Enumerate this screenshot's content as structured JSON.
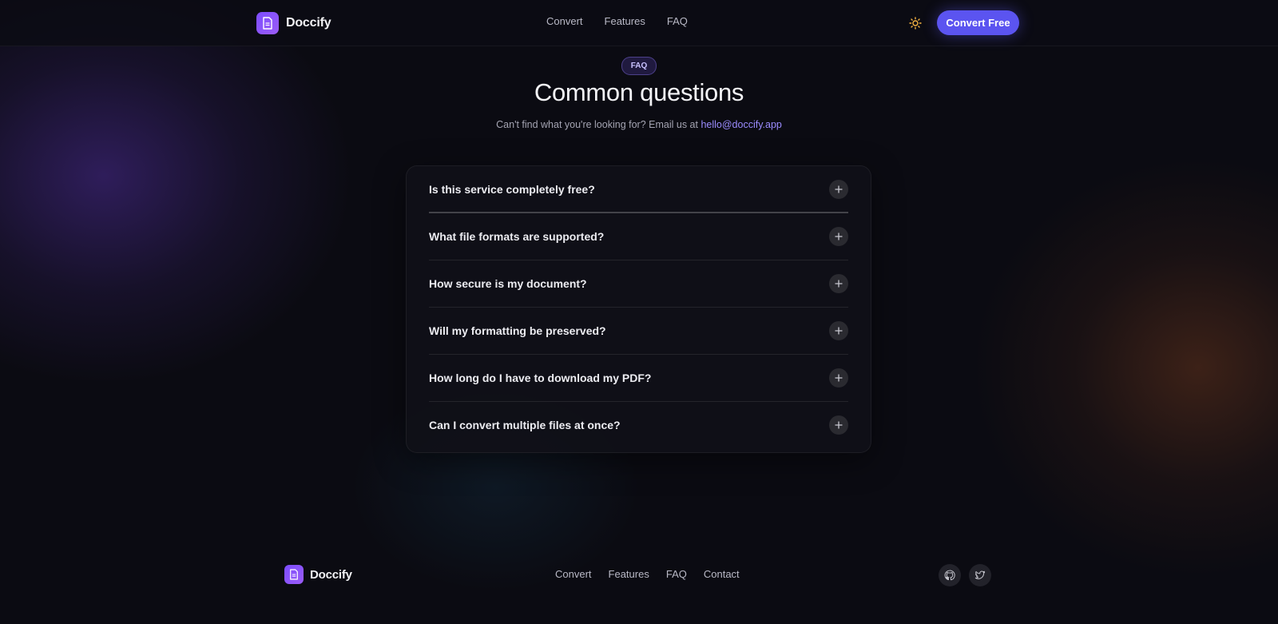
{
  "brand": {
    "name": "Doccify",
    "logo_icon": "document-icon",
    "accent": "#7c4dff"
  },
  "header": {
    "nav": [
      "Convert",
      "Features",
      "FAQ"
    ],
    "theme_icon": "sun-icon",
    "cta_label": "Convert Free",
    "cta_color": "#5b54f0"
  },
  "hero": {
    "badge": "FAQ",
    "title": "Common questions",
    "subtitle_prefix": "Can't find what you're looking for? Email us at ",
    "email": "hello@doccify.app"
  },
  "faq": {
    "items": [
      {
        "question": "Is this service completely free?"
      },
      {
        "question": "What file formats are supported?"
      },
      {
        "question": "How secure is my document?"
      },
      {
        "question": "Will my formatting be preserved?"
      },
      {
        "question": "How long do I have to download my PDF?"
      },
      {
        "question": "Can I convert multiple files at once?"
      }
    ],
    "expand_icon": "plus-icon"
  },
  "footer": {
    "brand": "Doccify",
    "nav": [
      "Convert",
      "Features",
      "FAQ",
      "Contact"
    ],
    "social_icons": [
      "github-icon",
      "twitter-icon"
    ]
  }
}
